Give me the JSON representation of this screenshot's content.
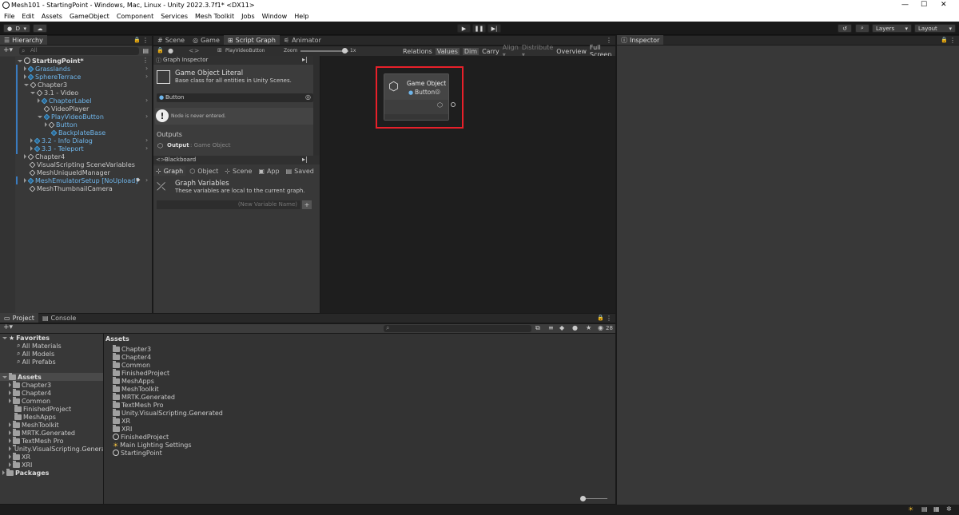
{
  "window": {
    "title": "Mesh101 - StartingPoint - Windows, Mac, Linux - Unity 2022.3.7f1* <DX11>",
    "min": "—",
    "max": "☐",
    "close": "✕"
  },
  "menu": [
    "File",
    "Edit",
    "Assets",
    "GameObject",
    "Component",
    "Services",
    "Mesh Toolkit",
    "Jobs",
    "Window",
    "Help"
  ],
  "toolbar": {
    "account": "D",
    "layers": "Layers",
    "layout": "Layout"
  },
  "hierarchy": {
    "tab": "Hierarchy",
    "search_placeholder": "All",
    "items": [
      {
        "label": "StartingPoint*",
        "bold": true
      },
      {
        "label": "Grasslands",
        "blue": true
      },
      {
        "label": "SphereTerrace",
        "blue": true
      },
      {
        "label": "Chapter3"
      },
      {
        "label": "3.1 - Video"
      },
      {
        "label": "ChapterLabel",
        "blue": true
      },
      {
        "label": "VideoPlayer"
      },
      {
        "label": "PlayVideoButton",
        "blue": true
      },
      {
        "label": "Button",
        "blue": true
      },
      {
        "label": "BackplateBase",
        "blue": true
      },
      {
        "label": "3.2 - Info Dialog",
        "blue": true
      },
      {
        "label": "3.3 - Teleport",
        "blue": true
      },
      {
        "label": "Chapter4"
      },
      {
        "label": "VisualScripting SceneVariables"
      },
      {
        "label": "MeshUniqueIdManager"
      },
      {
        "label": "MeshEmulatorSetup [NoUpload]",
        "blue": true
      },
      {
        "label": "MeshThumbnailCamera"
      }
    ]
  },
  "center_tabs": [
    "Scene",
    "Game",
    "Script Graph",
    "Animator"
  ],
  "graph_toolbar": {
    "graph_name": "PlayVideoButton",
    "zoom_label": "Zoom",
    "zoom_value": "1x",
    "zoom_fraction": 0.92,
    "buttons": [
      "Relations",
      "Values",
      "Dim",
      "Carry",
      "Align ▾",
      "Distribute ▾",
      "Overview",
      "Full Screen"
    ]
  },
  "graph_inspector": {
    "title": "Graph Inspector",
    "node_title": "Game Object Literal",
    "node_desc": "Base class for all entities in Unity Scenes.",
    "field_value": "Button",
    "warning": "Node is never entered.",
    "outputs_label": "Outputs",
    "output_name": "Output",
    "output_type": ": Game Object"
  },
  "blackboard": {
    "title": "Blackboard",
    "tabs": [
      "Graph",
      "Object",
      "Scene",
      "App",
      "Saved"
    ],
    "section_title": "Graph Variables",
    "section_desc": "These variables are local to the current graph.",
    "new_var_placeholder": "(New Variable Name)",
    "add": "+"
  },
  "graph_node": {
    "title": "Game Object",
    "value": "Button"
  },
  "inspector": {
    "tab": "Inspector"
  },
  "bottom_tabs": [
    "Project",
    "Console"
  ],
  "project": {
    "favorites_label": "Favorites",
    "favorites": [
      "All Materials",
      "All Models",
      "All Prefabs"
    ],
    "assets_label": "Assets",
    "tree": [
      "Chapter3",
      "Chapter4",
      "Common",
      "FinishedProject",
      "MeshApps",
      "MeshToolkit",
      "MRTK.Generated",
      "TextMesh Pro",
      "Unity.VisualScripting.Genera",
      "XR",
      "XRI"
    ],
    "packages_label": "Packages",
    "breadcrumb": "Assets",
    "folders": [
      "Chapter3",
      "Chapter4",
      "Common",
      "FinishedProject",
      "MeshApps",
      "MeshToolkit",
      "MRTK.Generated",
      "TextMesh Pro",
      "Unity.VisualScripting.Generated",
      "XR",
      "XRI"
    ],
    "files": [
      {
        "label": "FinishedProject",
        "icon": "unity-scene-icon"
      },
      {
        "label": "Main Lighting Settings",
        "icon": "lighting-settings-icon"
      },
      {
        "label": "StartingPoint",
        "icon": "unity-scene-icon"
      }
    ],
    "hidden_count": "28",
    "size_slider": 0.1
  },
  "colors": {
    "highlight": "#e8202a",
    "accent_blue": "#6fb5ea",
    "selected_tab": "#3c3c3c"
  }
}
